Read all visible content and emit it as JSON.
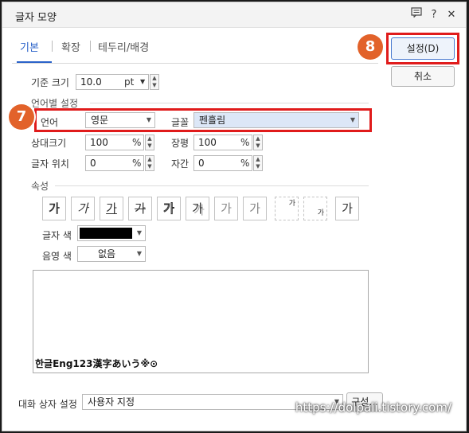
{
  "window": {
    "title": "글자 모양",
    "help_label": "?",
    "close_label": "✕"
  },
  "tabs": [
    {
      "label": "기본",
      "active": true
    },
    {
      "label": "확장",
      "active": false
    },
    {
      "label": "테두리/배경",
      "active": false
    }
  ],
  "buttons": {
    "settings": "설정(D)",
    "cancel": "취소",
    "config": "구성..."
  },
  "base_size": {
    "label": "기준 크기",
    "value": "10.0",
    "unit": "pt"
  },
  "language_settings": {
    "section": "언어별 설정",
    "language_label": "언어",
    "language_value": "영문",
    "font_label": "글꼴",
    "font_value": "펜흘림",
    "relative_size_label": "상대크기",
    "relative_size_value": "100",
    "width_label": "장평",
    "width_value": "100",
    "position_label": "글자 위치",
    "position_value": "0",
    "spacing_label": "자간",
    "spacing_value": "0",
    "percent": "%"
  },
  "attributes": {
    "section": "속성",
    "glyph": "가",
    "sub_glyph": "가",
    "text_color_label": "글자 색",
    "text_color": "#000000",
    "shade_color_label": "음영 색",
    "shade_color_value": "없음"
  },
  "preview": {
    "text": "한글Eng123漢字あいう※⊙"
  },
  "dialog_settings": {
    "label": "대화 상자 설정",
    "value": "사용자 지정"
  },
  "annotations": {
    "badge7": "7",
    "badge8": "8",
    "highlight_color": "#e01b1b",
    "badge_color": "#e2622a"
  },
  "watermark": "https://dolpali.tistory.com/"
}
